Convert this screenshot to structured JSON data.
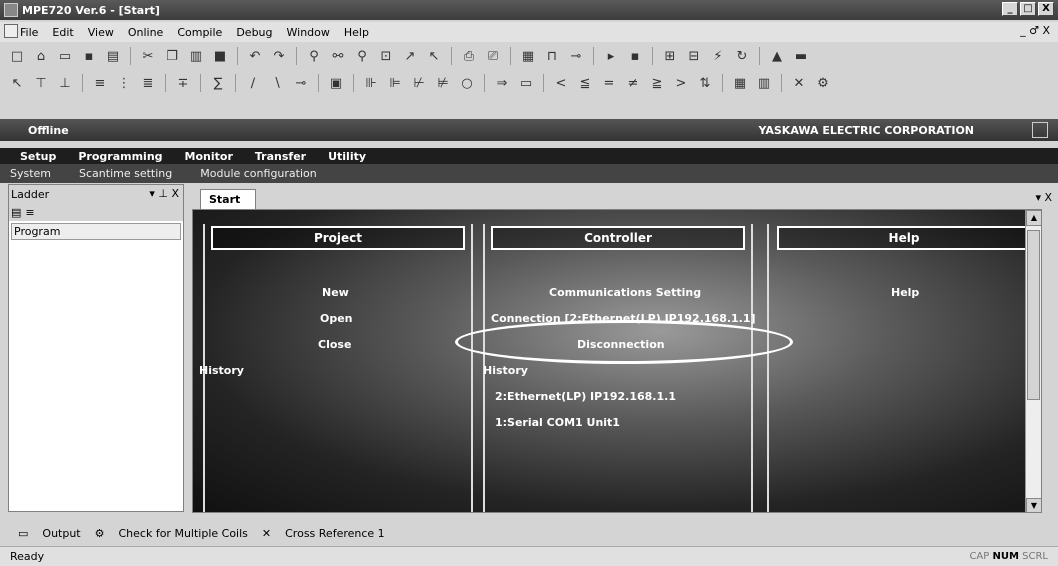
{
  "title": "MPE720 Ver.6 - [Start]",
  "window_controls": [
    "_",
    "□",
    "X"
  ],
  "menu": [
    "File",
    "Edit",
    "View",
    "Online",
    "Compile",
    "Debug",
    "Window",
    "Help"
  ],
  "mdi_controls": "_ ♂ X",
  "offline_label": "Offline",
  "corporation": "YASKAWA ELECTRIC CORPORATION",
  "top_tabs": [
    "Setup",
    "Programming",
    "Monitor",
    "Transfer",
    "Utility"
  ],
  "sub_tabs": [
    "System",
    "Scantime setting",
    "Module configuration"
  ],
  "ladder": {
    "title": "Ladder",
    "controls": "▾ ⊥ X",
    "item": "Program"
  },
  "start_tab": "Start",
  "start_controls": "▾ X",
  "project": {
    "heading": "Project",
    "items": [
      "New",
      "Open",
      "Close"
    ],
    "history": "History"
  },
  "controller": {
    "heading": "Controller",
    "items": [
      "Communications Setting",
      "Connection [2:Ethernet(LP) IP192.168.1.1]",
      "Disconnection"
    ],
    "history": "History",
    "history_items": [
      "2:Ethernet(LP) IP192.168.1.1",
      "1:Serial COM1 Unit1"
    ]
  },
  "help": {
    "heading": "Help",
    "items": [
      "Help"
    ]
  },
  "bottom_tabs": [
    "Output",
    "Check for Multiple Coils",
    "Cross Reference 1"
  ],
  "status_left": "Ready",
  "status_right": {
    "cap": "CAP",
    "num": "NUM",
    "scrl": "SCRL"
  }
}
